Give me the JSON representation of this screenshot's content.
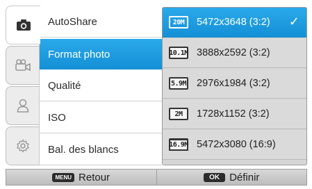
{
  "tabs": [
    {
      "icon": "camera-icon",
      "active": true
    },
    {
      "icon": "video-camera-icon",
      "active": false
    },
    {
      "icon": "user-icon",
      "active": false
    },
    {
      "icon": "gear-icon",
      "active": false
    }
  ],
  "menu": {
    "items": [
      {
        "label": "AutoShare"
      },
      {
        "label": "Format photo",
        "selected": true
      },
      {
        "label": "Qualité"
      },
      {
        "label": "ISO"
      },
      {
        "label": "Bal. des blancs"
      }
    ]
  },
  "submenu": {
    "options": [
      {
        "icon_text": "20M",
        "label": "5472x3648 (3:2)",
        "current": true,
        "checked": true
      },
      {
        "icon_text": "10.1M",
        "label": "3888x2592 (3:2)"
      },
      {
        "icon_text": "5.9M",
        "label": "2976x1984 (3:2)"
      },
      {
        "icon_text": "2M",
        "label": "1728x1152 (3:2)"
      },
      {
        "icon_text": "16.9M",
        "label": "5472x3080 (16:9)"
      }
    ],
    "check_glyph": "✓"
  },
  "bottom": {
    "back_key": "MENU",
    "back_label": "Retour",
    "ok_key": "OK",
    "ok_label": "Définir"
  }
}
